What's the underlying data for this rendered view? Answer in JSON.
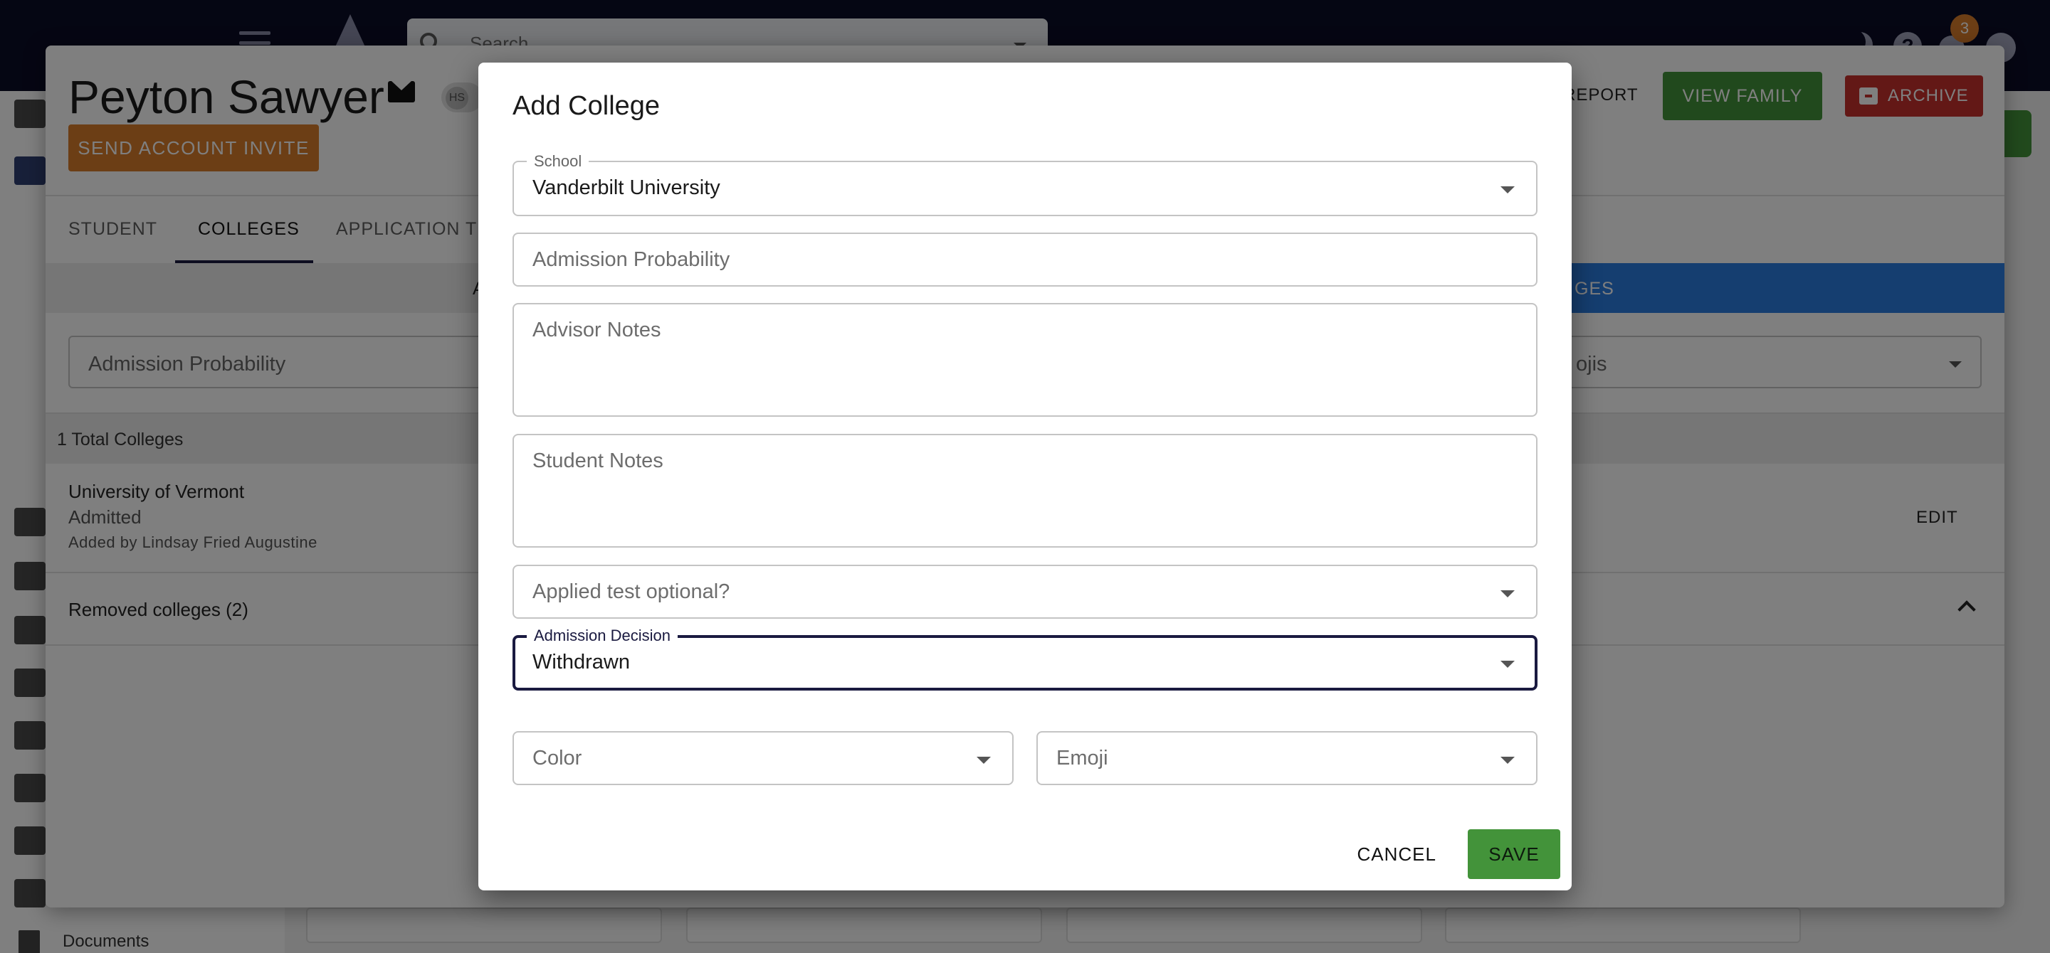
{
  "topbar": {
    "search_placeholder": "Search",
    "notification_count": "3"
  },
  "sidebar": {
    "documents_label": "Documents"
  },
  "student": {
    "name": "Peyton Sawyer",
    "chip_initials": "HS",
    "send_invite_label": "SEND ACCOUNT INVITE",
    "report_label": "REPORT",
    "view_family_label": "VIEW FAMILY",
    "archive_label": "ARCHIVE"
  },
  "tabs": [
    {
      "label": "STUDENT"
    },
    {
      "label": "COLLEGES"
    },
    {
      "label": "APPLICATION TR"
    }
  ],
  "colleges_view": {
    "band_left_fragment": "A",
    "band_right_fragment": "GES",
    "filter_admission_probability": "Admission Probability",
    "filter_emojis_fragment": "ojis",
    "total_label": "1 Total Colleges",
    "rows": [
      {
        "name": "University of Vermont",
        "status": "Admitted",
        "added_by": "Added by Lindsay Fried Augustine",
        "edit_label": "EDIT"
      }
    ],
    "removed_label": "Removed colleges (2)"
  },
  "modal": {
    "title": "Add College",
    "school": {
      "label": "School",
      "value": "Vanderbilt University"
    },
    "admission_probability_placeholder": "Admission Probability",
    "advisor_notes_placeholder": "Advisor Notes",
    "student_notes_placeholder": "Student Notes",
    "applied_test_optional_placeholder": "Applied test optional?",
    "admission_decision": {
      "label": "Admission Decision",
      "value": "Withdrawn"
    },
    "color_placeholder": "Color",
    "emoji_placeholder": "Emoji",
    "cancel_label": "CANCEL",
    "save_label": "SAVE"
  },
  "colors": {
    "topbar": "#0b0c26",
    "accent_green": "#43933a",
    "accent_orange": "#d97c2b",
    "accent_red": "#c6302d",
    "accent_blue": "#2a7de1",
    "focus_navy": "#1a1a40"
  }
}
